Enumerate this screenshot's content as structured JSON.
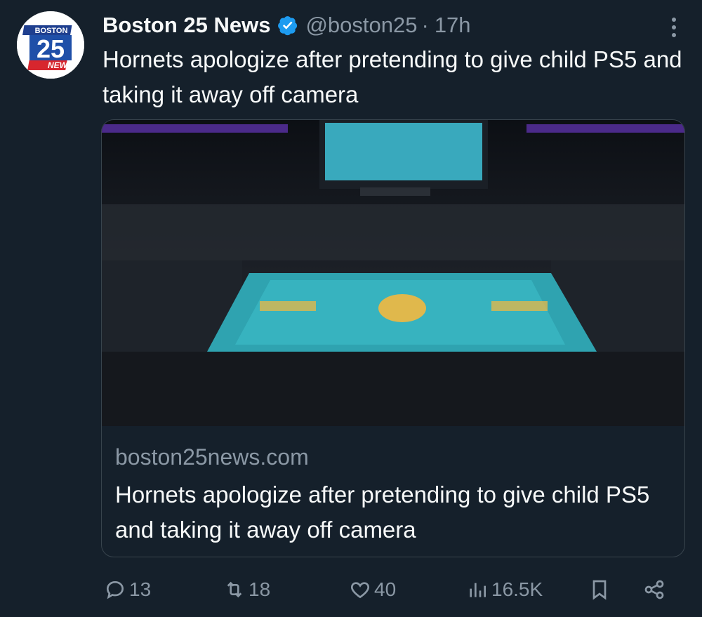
{
  "author": {
    "name": "Boston 25 News",
    "handle": "@boston25",
    "separator": "·",
    "time": "17h",
    "avatar_top": "BOSTON",
    "avatar_number": "25",
    "avatar_bottom": "NEWS",
    "verified": true
  },
  "tweet": {
    "text": "Hornets apologize after pretending to give child PS5 and taking it away off camera"
  },
  "card": {
    "image_description_icon": "basketball-arena-photo",
    "domain": "boston25news.com",
    "title": "Hornets apologize after pretending to give child PS5 and taking it away off camera"
  },
  "actions": {
    "reply_count": "13",
    "retweet_count": "18",
    "like_count": "40",
    "views_count": "16.5K"
  },
  "colors": {
    "background": "#15202b",
    "text": "#f7f9f9",
    "muted": "#8b98a5",
    "verified_blue": "#1d9bf0",
    "border": "#38444d",
    "court_teal": "#2fa3b0"
  }
}
